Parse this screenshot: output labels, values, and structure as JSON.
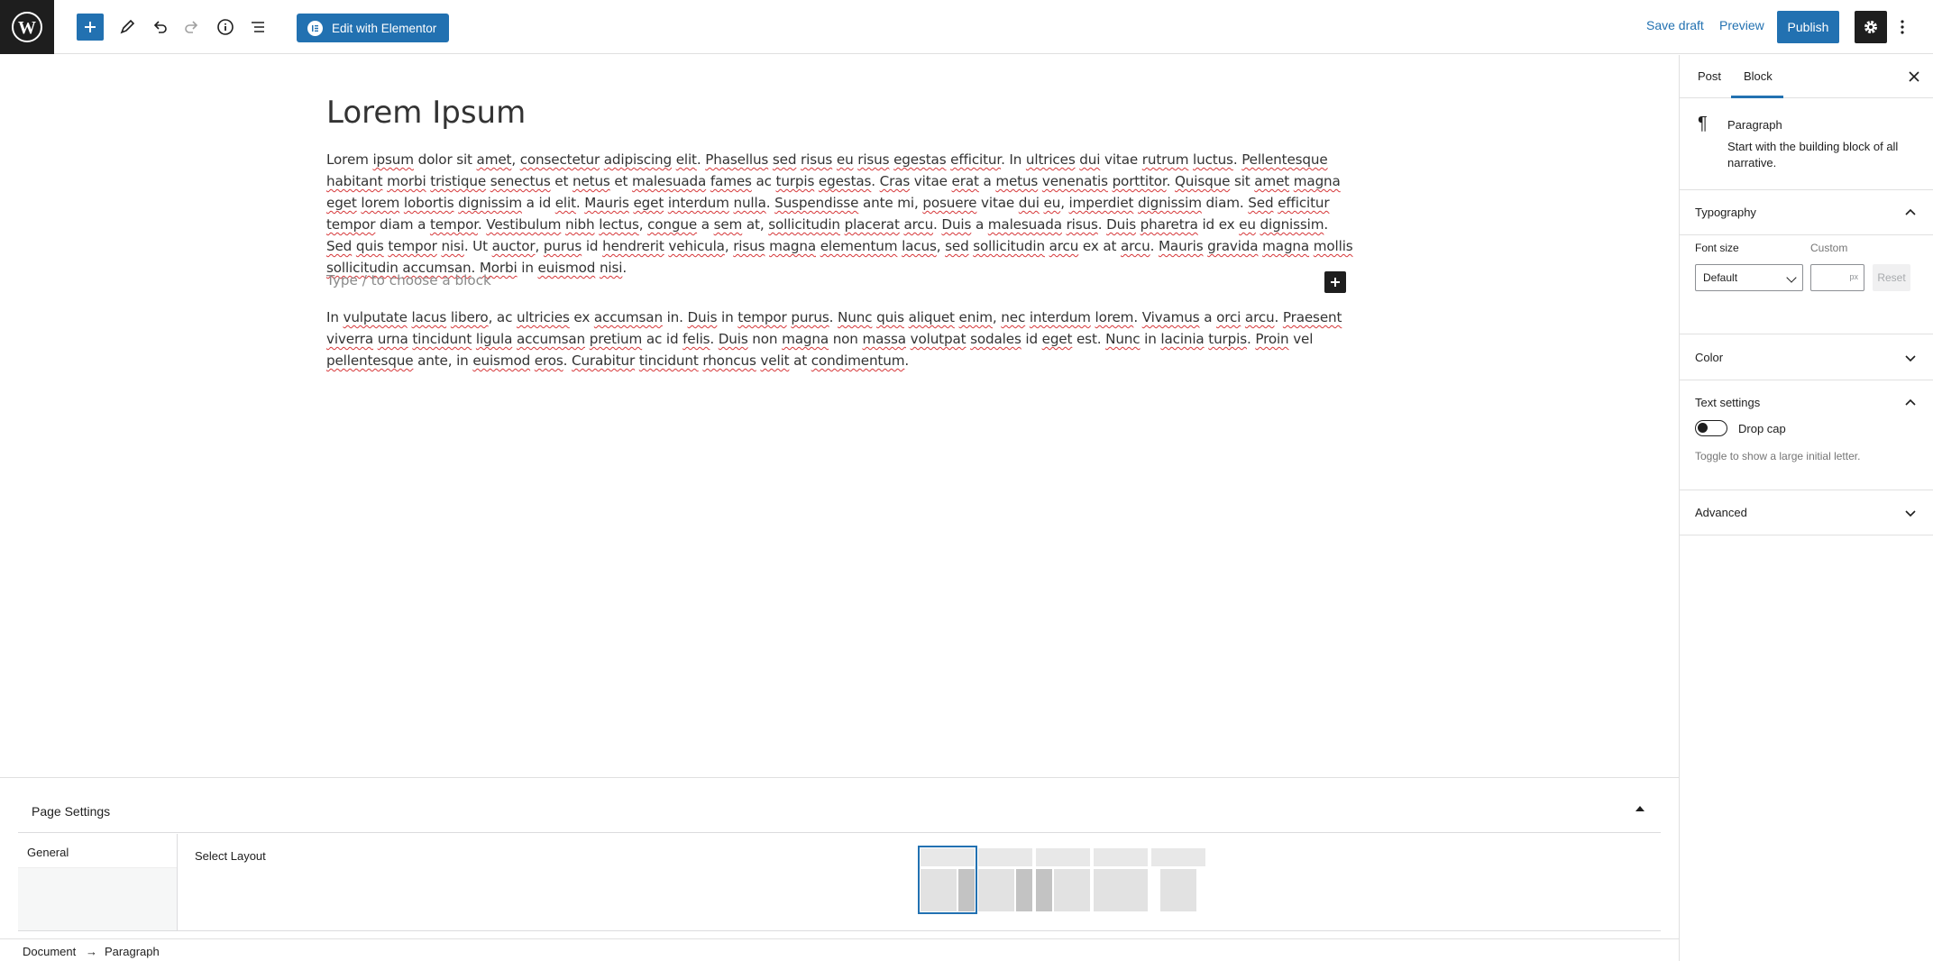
{
  "toolbar": {
    "elementor_label": "Edit with Elementor",
    "save_draft": "Save draft",
    "preview": "Preview",
    "publish": "Publish"
  },
  "post": {
    "title": "Lorem Ipsum",
    "placeholder": "Type / to choose a block"
  },
  "page_settings": {
    "title": "Page Settings",
    "nav_general": "General",
    "select_layout": "Select Layout",
    "layout_options": [
      "right-sidebar",
      "left-sidebar",
      "both-sidebars",
      "full-width",
      "no-sidebar-narrow"
    ]
  },
  "breadcrumb": {
    "document": "Document",
    "separator": "→",
    "paragraph": "Paragraph"
  },
  "sidebar": {
    "tab_post": "Post",
    "tab_block": "Block",
    "block_name": "Paragraph",
    "block_desc": "Start with the building block of all narrative.",
    "typography": "Typography",
    "font_size_label": "Font size",
    "custom_label": "Custom",
    "font_size_value": "Default",
    "unit": "px",
    "reset": "Reset",
    "color": "Color",
    "text_settings": "Text settings",
    "drop_cap": "Drop cap",
    "drop_cap_help": "Toggle to show a large initial letter.",
    "advanced": "Advanced"
  },
  "colors": {
    "accent": "#2271b1",
    "dark": "#1e1e1e",
    "spellcheck": "#d63638"
  }
}
